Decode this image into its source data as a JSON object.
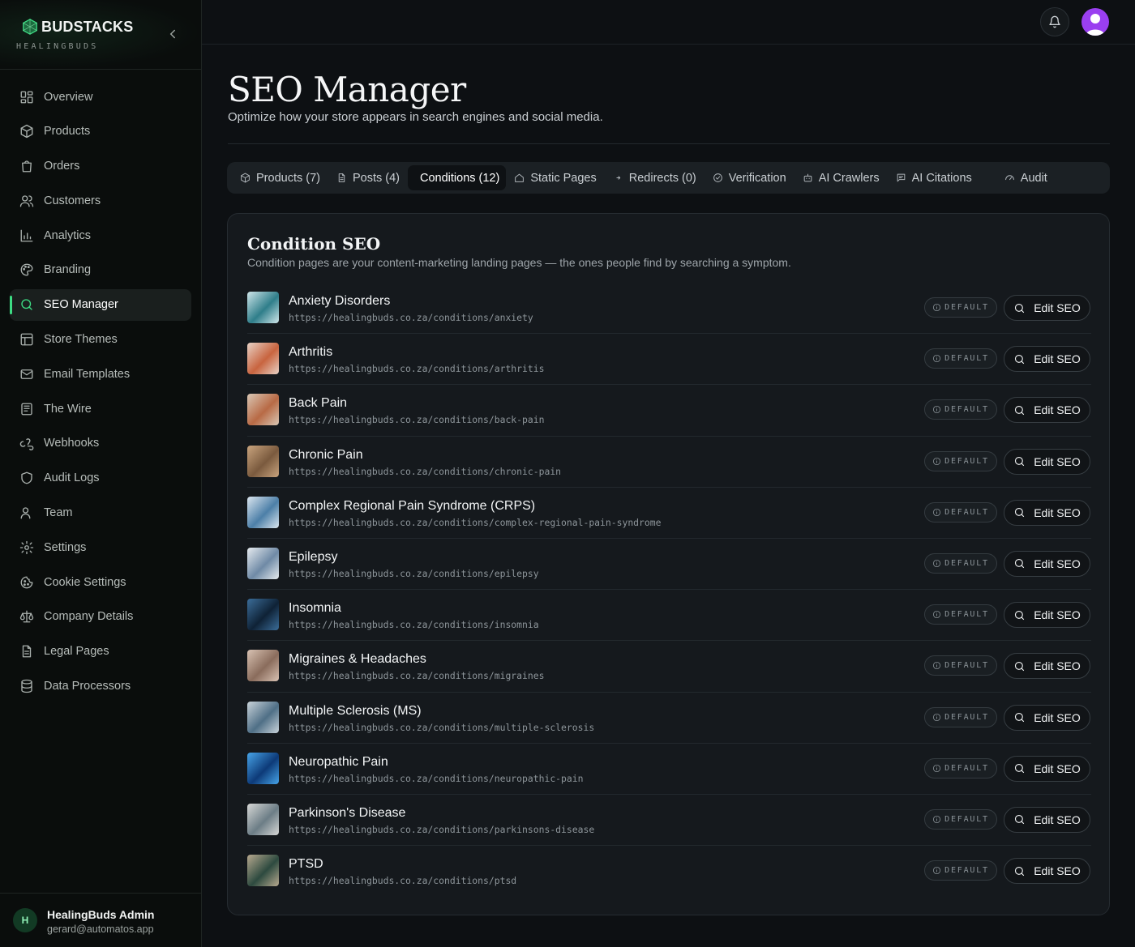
{
  "sidebar": {
    "brand_name": "BUDSTACKS",
    "brand_sub": "HEALINGBUDS",
    "items": [
      {
        "label": "Overview",
        "icon": "grid-icon"
      },
      {
        "label": "Products",
        "icon": "box-icon"
      },
      {
        "label": "Orders",
        "icon": "shopping-bag-icon"
      },
      {
        "label": "Customers",
        "icon": "users-icon"
      },
      {
        "label": "Analytics",
        "icon": "bar-chart-icon"
      },
      {
        "label": "Branding",
        "icon": "palette-icon"
      },
      {
        "label": "SEO Manager",
        "icon": "search-icon",
        "active": true
      },
      {
        "label": "Store Themes",
        "icon": "layout-icon"
      },
      {
        "label": "Email Templates",
        "icon": "mail-icon"
      },
      {
        "label": "The Wire",
        "icon": "newspaper-icon"
      },
      {
        "label": "Webhooks",
        "icon": "webhook-icon"
      },
      {
        "label": "Audit Logs",
        "icon": "shield-icon"
      },
      {
        "label": "Team",
        "icon": "user-icon"
      },
      {
        "label": "Settings",
        "icon": "gear-icon"
      },
      {
        "label": "Cookie Settings",
        "icon": "cookie-icon"
      },
      {
        "label": "Company Details",
        "icon": "scale-icon"
      },
      {
        "label": "Legal Pages",
        "icon": "file-text-icon"
      },
      {
        "label": "Data Processors",
        "icon": "database-icon"
      }
    ],
    "user": {
      "initial": "H",
      "name": "HealingBuds Admin",
      "email": "gerard@automatos.app"
    }
  },
  "header": {
    "title": "SEO Manager",
    "subtitle": "Optimize how your store appears in search engines and social media."
  },
  "tabs": [
    {
      "label": "Products (7)",
      "icon": "box-icon"
    },
    {
      "label": "Posts (4)",
      "icon": "file-icon"
    },
    {
      "label": "Conditions (12)",
      "icon": "",
      "active": true
    },
    {
      "label": "Static Pages",
      "icon": "home-icon"
    },
    {
      "label": "Redirects (0)",
      "icon": "arrow-icon"
    },
    {
      "label": "Verification",
      "icon": "check-circle-icon"
    },
    {
      "label": "AI Crawlers",
      "icon": "bot-icon"
    },
    {
      "label": "AI Citations",
      "icon": "message-icon"
    },
    {
      "label": "Audit",
      "icon": "gauge-icon"
    }
  ],
  "card": {
    "title": "Condition SEO",
    "description": "Condition pages are your content-marketing landing pages — the ones people find by searching a symptom.",
    "badge_label": "DEFAULT",
    "button_label": "Edit SEO",
    "rows": [
      {
        "title": "Anxiety Disorders",
        "url": "https://healingbuds.co.za/conditions/anxiety",
        "thumb_a": "#2f7e8a",
        "thumb_b": "#cfe6ea"
      },
      {
        "title": "Arthritis",
        "url": "https://healingbuds.co.za/conditions/arthritis",
        "thumb_a": "#c8643f",
        "thumb_b": "#e8d2c6"
      },
      {
        "title": "Back Pain",
        "url": "https://healingbuds.co.za/conditions/back-pain",
        "thumb_a": "#b86a45",
        "thumb_b": "#d9c7b5"
      },
      {
        "title": "Chronic Pain",
        "url": "https://healingbuds.co.za/conditions/chronic-pain",
        "thumb_a": "#7a5a3e",
        "thumb_b": "#c9a47e"
      },
      {
        "title": "Complex Regional Pain Syndrome (CRPS)",
        "url": "https://healingbuds.co.za/conditions/complex-regional-pain-syndrome",
        "thumb_a": "#4c7fa8",
        "thumb_b": "#dbe6ef"
      },
      {
        "title": "Epilepsy",
        "url": "https://healingbuds.co.za/conditions/epilepsy",
        "thumb_a": "#6f8aa6",
        "thumb_b": "#e6ebef"
      },
      {
        "title": "Insomnia",
        "url": "https://healingbuds.co.za/conditions/insomnia",
        "thumb_a": "#0f2236",
        "thumb_b": "#3b6d99"
      },
      {
        "title": "Migraines & Headaches",
        "url": "https://healingbuds.co.za/conditions/migraines",
        "thumb_a": "#8a6c5c",
        "thumb_b": "#d8c2b3"
      },
      {
        "title": "Multiple Sclerosis (MS)",
        "url": "https://healingbuds.co.za/conditions/multiple-sclerosis",
        "thumb_a": "#4f6f86",
        "thumb_b": "#c9d3da"
      },
      {
        "title": "Neuropathic Pain",
        "url": "https://healingbuds.co.za/conditions/neuropathic-pain",
        "thumb_a": "#0d3a78",
        "thumb_b": "#47a4e8"
      },
      {
        "title": "Parkinson's Disease",
        "url": "https://healingbuds.co.za/conditions/parkinsons-disease",
        "thumb_a": "#6c7d86",
        "thumb_b": "#d7d8d6"
      },
      {
        "title": "PTSD",
        "url": "https://healingbuds.co.za/conditions/ptsd",
        "thumb_a": "#2d4a3f",
        "thumb_b": "#b7a98f"
      }
    ]
  },
  "colors": {
    "accent": "#3ddc84",
    "avatar": "#9a3ff0"
  }
}
